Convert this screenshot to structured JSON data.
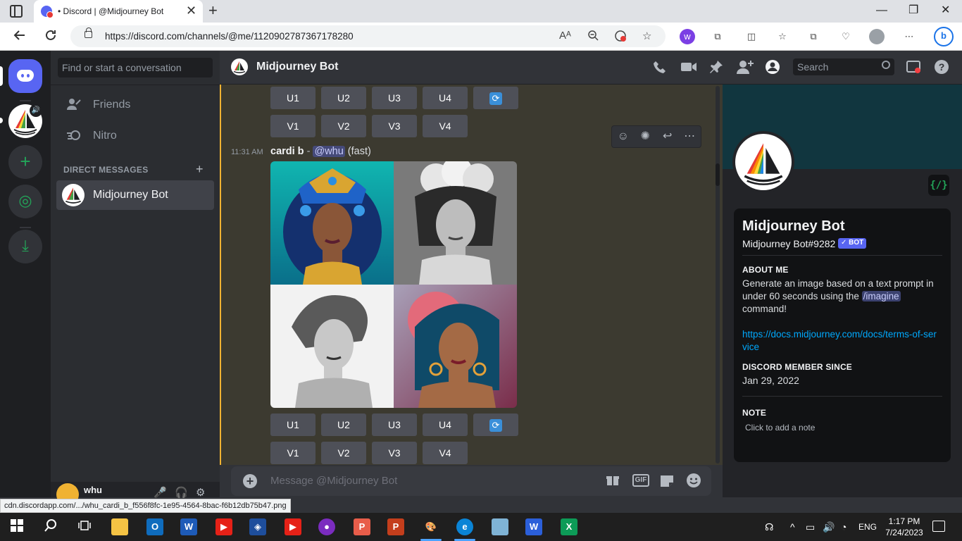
{
  "browser": {
    "tab_title": "• Discord | @Midjourney Bot",
    "tab_close": "✕",
    "new_tab": "+",
    "url": "https://discord.com/channels/@me/1120902787367178280",
    "window_controls": [
      "—",
      "❐",
      "✕"
    ],
    "status_link": "cdn.discordapp.com/.../whu_cardi_b_f556f8fc-1e95-4564-8bac-f6b12db75b47.png"
  },
  "guilds": {
    "add": "+",
    "explore": "◎",
    "download": "⤓",
    "speaker": "🔊"
  },
  "dm_panel": {
    "search_placeholder": "Find or start a conversation",
    "nav": [
      {
        "label": "Friends",
        "icon": "friends-icon"
      },
      {
        "label": "Nitro",
        "icon": "nitro-icon"
      }
    ],
    "section_title": "DIRECT MESSAGES",
    "add": "+",
    "items": [
      {
        "label": "Midjourney Bot"
      }
    ]
  },
  "user_panel": {
    "name": "whu"
  },
  "chat": {
    "title": "Midjourney Bot",
    "search_placeholder": "Search",
    "upscale_buttons": [
      "U1",
      "U2",
      "U3",
      "U4"
    ],
    "variation_buttons": [
      "V1",
      "V2",
      "V3",
      "V4"
    ],
    "refresh_glyph": "🔄",
    "message": {
      "time": "11:31 AM",
      "prompt": "cardi b",
      "separator": " - ",
      "mention": "@whu",
      "speed": "(fast)"
    },
    "composer_placeholder": "Message @Midjourney Bot",
    "composer_add": "+",
    "gif_label": "GIF"
  },
  "profile": {
    "dev_badge": "{/}",
    "name": "Midjourney Bot",
    "tag": "Midjourney Bot#9282",
    "bot_badge": "✓ BOT",
    "about_title": "ABOUT ME",
    "about_text_1": "Generate an image based on a text prompt in under 60 seconds using the ",
    "about_command": "/imagine",
    "about_text_2": " command!",
    "about_link": "https://docs.midjourney.com/docs/terms-of-service",
    "member_title": "DISCORD MEMBER SINCE",
    "member_since": "Jan 29, 2022",
    "note_title": "NOTE",
    "note_placeholder": "Click to add a note"
  },
  "taskbar": {
    "lang": "ENG",
    "time": "1:17 PM",
    "date": "7/24/2023"
  },
  "colors": {
    "blurple": "#5865f2",
    "highlight_bg": "#3c3a30",
    "highlight_bar": "#f0b232",
    "link": "#00a8fc",
    "bot_dev_green": "#23a559"
  }
}
